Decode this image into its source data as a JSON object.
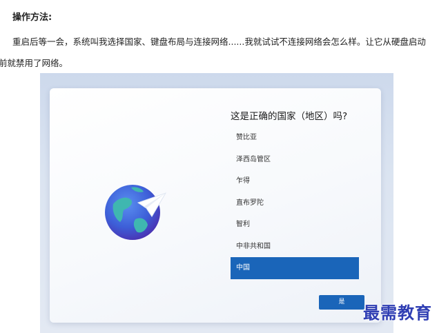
{
  "article": {
    "heading": "操作方法:",
    "paragraph_line1": "重启后等一会，系统叫我选择国家、键盘布局与连接网络......我就试试不连接网络会怎么样。让它从硬盘启动",
    "paragraph_line2": "前就禁用了网络。"
  },
  "screenshot": {
    "question": "这是正确的国家（地区）吗?",
    "countries": [
      "赞比亚",
      "泽西岛管区",
      "乍得",
      "直布罗陀",
      "智利",
      "中非共和国",
      "中国"
    ],
    "selected": "中国",
    "yes_button": "是"
  },
  "watermark": "最需教育",
  "colors": {
    "accent": "#1a65b9",
    "watermark": "#2f3eb3"
  }
}
